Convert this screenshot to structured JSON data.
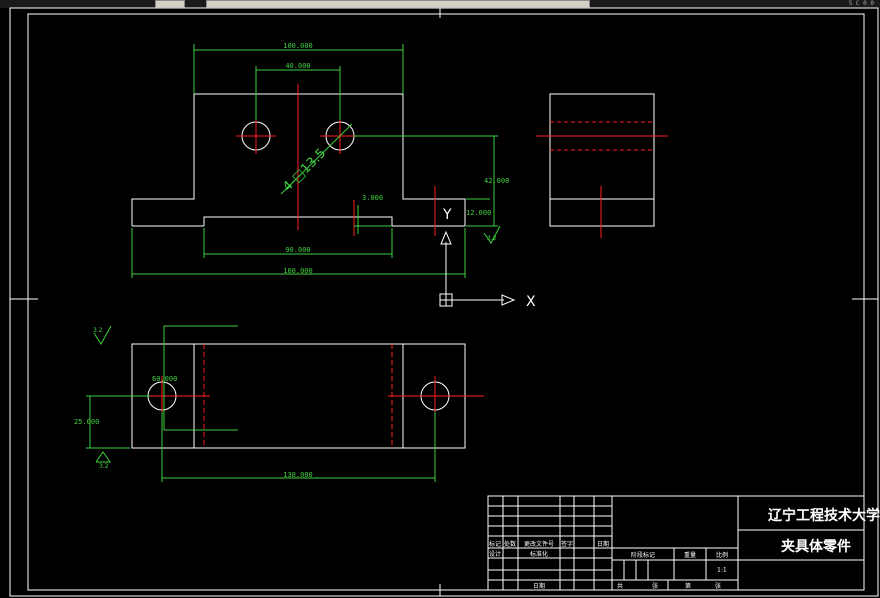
{
  "toolbar": {
    "coordinate_readout": "5 C 0 0"
  },
  "drawing": {
    "dimensions": {
      "top_width": "100.000",
      "hole_spacing_top": "40.000",
      "hole_note": "4-□13.5",
      "right_height": "42.000",
      "step_height": "12.000",
      "step_offset": "3.000",
      "slot_width": "90.000",
      "overall_width": "160.000",
      "hole_dia_bottom": "60.000",
      "hole_offset_bottom": "25.000",
      "hole_spacing_bottom": "130.000"
    },
    "roughness": {
      "r1": "3.2",
      "r2": "3.2",
      "r3": "3.2",
      "r4": "3.2"
    },
    "ucs": {
      "x": "X",
      "y": "Y"
    }
  },
  "title_block": {
    "school": "辽宁工程技术大学",
    "part_name": "夹具体零件",
    "rev_row": [
      "标记",
      "处数",
      "更改文件号",
      "签字",
      "日期"
    ],
    "sign_row": [
      "设计",
      "",
      "标准化",
      "",
      ""
    ],
    "stage_labels": [
      "阶段标记",
      "重量",
      "比例"
    ],
    "scale": "1:1",
    "bottom_labels": [
      "共",
      "张",
      "第",
      "张"
    ],
    "check_label": "日期"
  }
}
